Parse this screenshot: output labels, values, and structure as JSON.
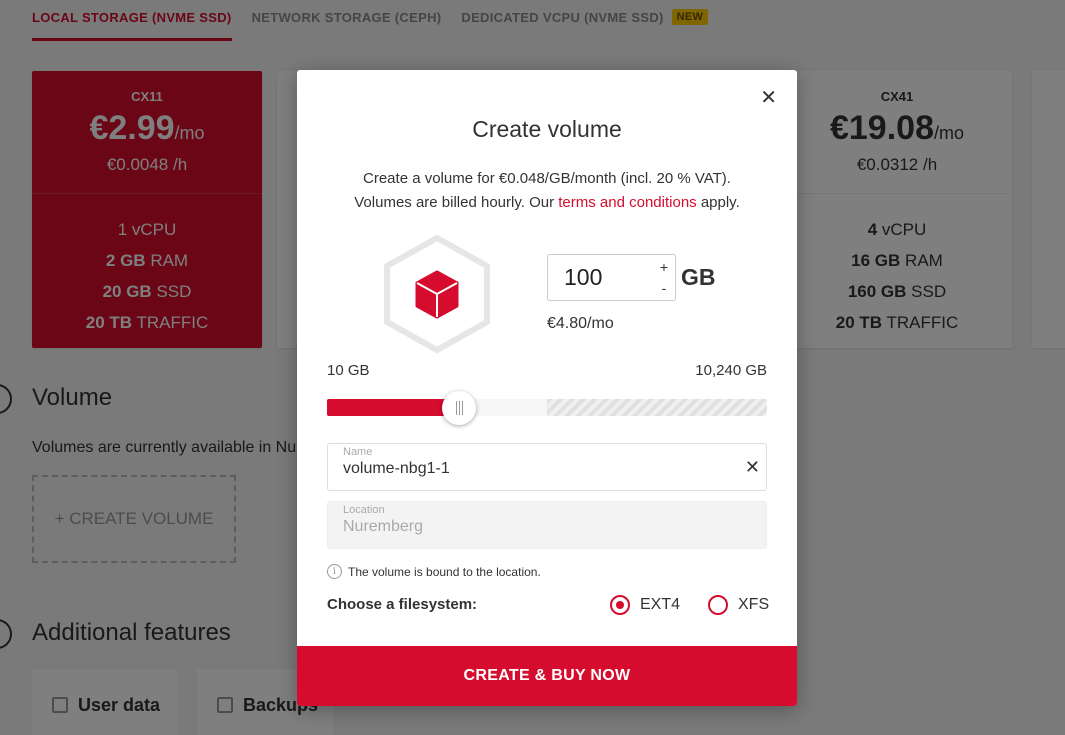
{
  "tabs": [
    {
      "label": "LOCAL STORAGE (NVME SSD)"
    },
    {
      "label": "NETWORK STORAGE (CEPH)"
    },
    {
      "label": "DEDICATED VCPU (NVME SSD)",
      "badge": "NEW"
    }
  ],
  "plans": [
    {
      "name": "CX11",
      "price": "€2.99",
      "per": "/mo",
      "hourly": "€0.0048 /h",
      "specs": [
        {
          "v": "1",
          "u": "vCPU"
        },
        {
          "v": "2 GB",
          "u": "RAM"
        },
        {
          "v": "20 GB",
          "u": "SSD"
        },
        {
          "v": "20 TB",
          "u": "TRAFFIC"
        }
      ]
    },
    {
      "name": "CX41",
      "price": "€19.08",
      "per": "/mo",
      "hourly": "€0.0312 /h",
      "specs": [
        {
          "v": "4",
          "u": "vCPU"
        },
        {
          "v": "16 GB",
          "u": "RAM"
        },
        {
          "v": "160 GB",
          "u": "SSD"
        },
        {
          "v": "20 TB",
          "u": "TRAFFIC"
        }
      ]
    }
  ],
  "sections": {
    "volume_title": "Volume",
    "volume_text": "Volumes are currently available in Nur",
    "create_volume_label": "+ CREATE VOLUME",
    "features_title": "Additional features",
    "feature_user_data": "User data",
    "feature_backups": "Backups"
  },
  "modal": {
    "title": "Create volume",
    "desc_line1": "Create a volume for €0.048/GB/month (incl. 20 % VAT).",
    "desc_line2_prefix": "Volumes are billed hourly. Our ",
    "desc_link": "terms and conditions",
    "desc_line2_suffix": " apply.",
    "size_value": "100",
    "size_unit": "GB",
    "stepper_plus": "+",
    "stepper_minus": "-",
    "monthly_price": "€4.80/mo",
    "range_min": "10 GB",
    "range_max": "10,240 GB",
    "slider_fill_fraction": 0.3,
    "name_label": "Name",
    "name_value": "volume-nbg1-1",
    "location_label": "Location",
    "location_value": "Nuremberg",
    "info_text": "The volume is bound to the location.",
    "fs_label": "Choose a filesystem:",
    "fs_options": [
      "EXT4",
      "XFS"
    ],
    "fs_selected": "EXT4",
    "submit_label": "CREATE & BUY NOW"
  },
  "colors": {
    "accent": "#d50c2d",
    "badge": "#ffcc00"
  },
  "icons": {
    "close": "close-icon",
    "volume": "cube-icon",
    "info": "info-icon"
  }
}
